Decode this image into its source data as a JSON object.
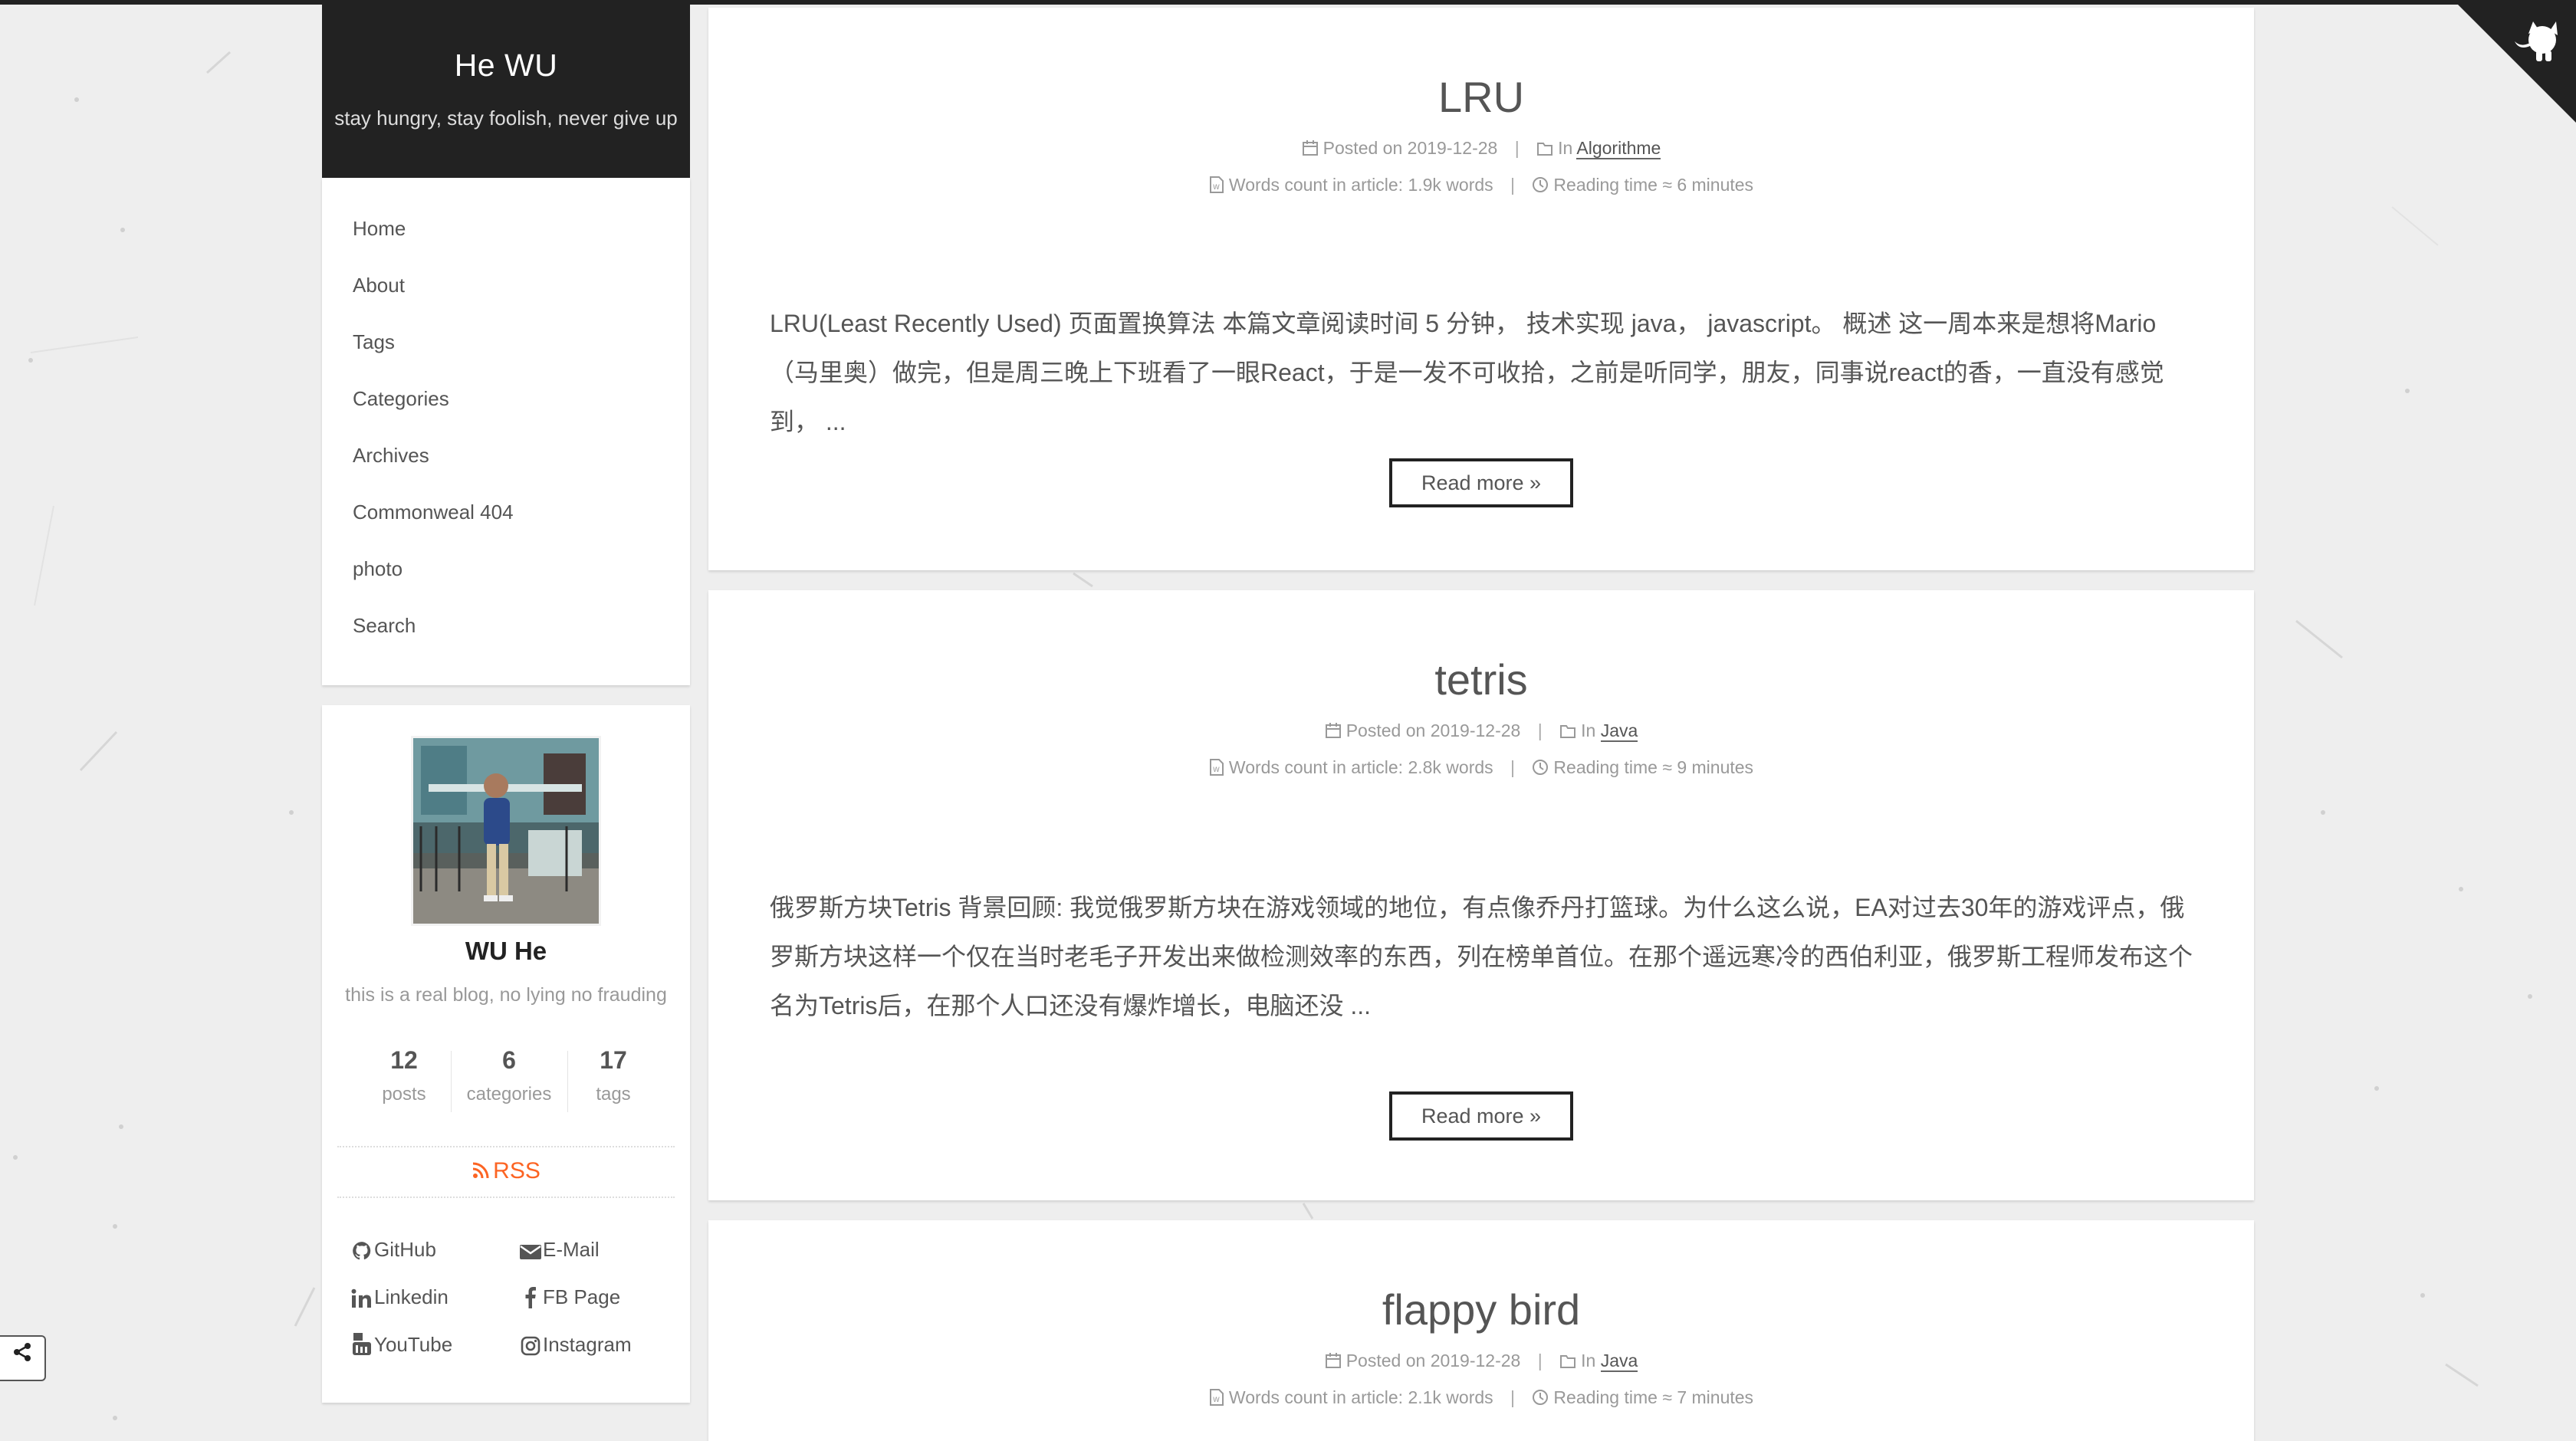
{
  "site": {
    "title": "He WU",
    "subtitle": "stay hungry, stay foolish, never give up"
  },
  "menu": {
    "items": [
      "Home",
      "About",
      "Tags",
      "Categories",
      "Archives",
      "Commonweal 404",
      "photo",
      "Search"
    ]
  },
  "author": {
    "name": "WU He",
    "description": "this is a real blog, no lying no frauding",
    "stats": [
      {
        "count": "12",
        "label": "posts"
      },
      {
        "count": "6",
        "label": "categories"
      },
      {
        "count": "17",
        "label": "tags"
      }
    ],
    "rss_label": "RSS",
    "links": [
      {
        "label": "GitHub",
        "icon": "github-icon"
      },
      {
        "label": "E-Mail",
        "icon": "envelope-icon"
      },
      {
        "label": "Linkedin",
        "icon": "linkedin-icon"
      },
      {
        "label": "FB Page",
        "icon": "facebook-icon"
      },
      {
        "label": "YouTube",
        "icon": "youtube-icon"
      },
      {
        "label": "Instagram",
        "icon": "instagram-icon"
      }
    ]
  },
  "posts": [
    {
      "title": "LRU",
      "posted_label": "Posted on",
      "date": "2019-12-28",
      "in_label": "In",
      "category": "Algorithme",
      "words_label": "Words count in article:",
      "words": "1.9k words",
      "reading_label": "Reading time ≈",
      "reading": "6 minutes",
      "excerpt": "LRU(Least Recently Used) 页面置换算法 本篇文章阅读时间 5 分钟， 技术实现 java， javascript。 概述 这一周本来是想将Mario（马里奥）做完，但是周三晚上下班看了一眼React，于是一发不可收拾，之前是听同学，朋友，同事说react的香，一直没有感觉到， ...",
      "read_more": "Read more »"
    },
    {
      "title": "tetris",
      "posted_label": "Posted on",
      "date": "2019-12-28",
      "in_label": "In",
      "category": "Java",
      "words_label": "Words count in article:",
      "words": "2.8k words",
      "reading_label": "Reading time ≈",
      "reading": "9 minutes",
      "excerpt": "俄罗斯方块Tetris 背景回顾: 我觉俄罗斯方块在游戏领域的地位，有点像乔丹打篮球。为什么这么说，EA对过去30年的游戏评点，俄罗斯方块这样一个仅在当时老毛子开发出来做检测效率的东西，列在榜单首位。在那个遥远寒冷的西伯利亚，俄罗斯工程师发布这个名为Tetris后，在那个人口还没有爆炸增长，电脑还没 ...",
      "read_more": "Read more »"
    },
    {
      "title": "flappy bird",
      "posted_label": "Posted on",
      "date": "2019-12-28",
      "in_label": "In",
      "category": "Java",
      "words_label": "Words count in article:",
      "words": "2.1k words",
      "reading_label": "Reading time ≈",
      "reading": "7 minutes"
    }
  ],
  "colors": {
    "header_bg": "#222222",
    "page_bg": "#eeeeee",
    "card_bg": "#ffffff",
    "rss": "#fc6423",
    "text": "#555555",
    "meta": "#999999"
  }
}
